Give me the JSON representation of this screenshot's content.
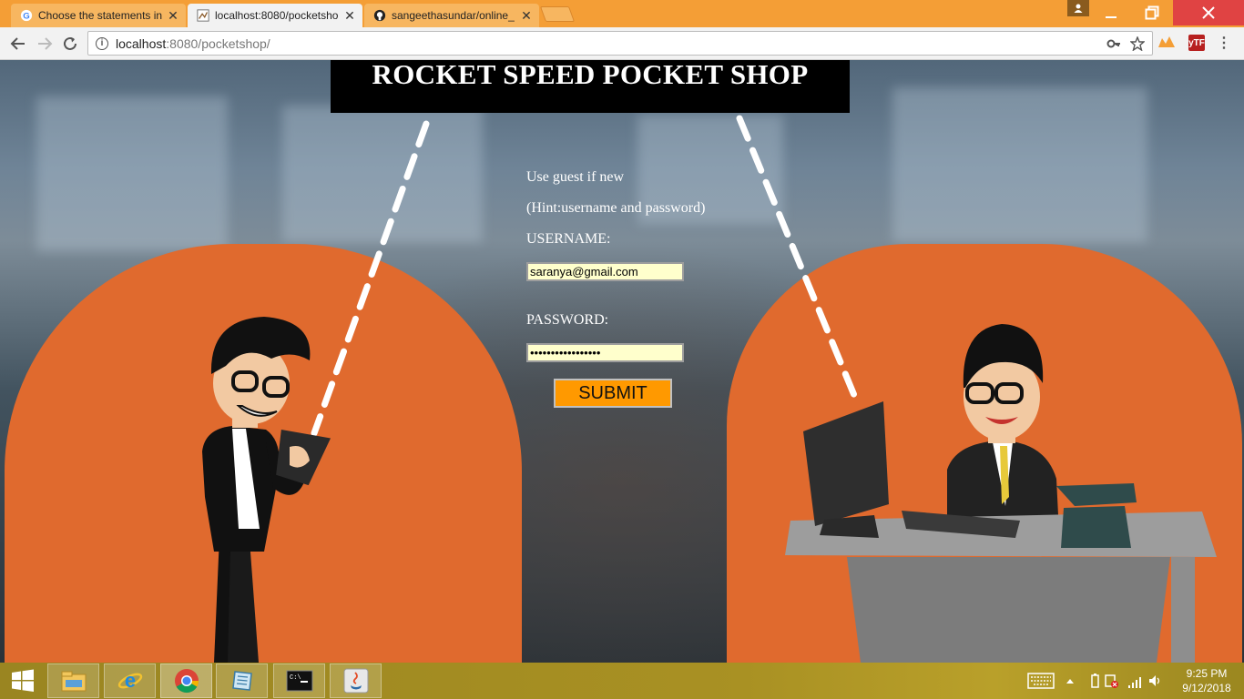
{
  "browser": {
    "tabs": [
      {
        "title": "Choose the statements in",
        "favicon": "google-icon",
        "active": false
      },
      {
        "title": "localhost:8080/pocketsho",
        "favicon": "page-icon",
        "active": true
      },
      {
        "title": "sangeethasundar/online_",
        "favicon": "github-icon",
        "active": false
      }
    ],
    "url_host": "localhost",
    "url_path": ":8080/pocketshop/"
  },
  "page": {
    "title": "ROCKET SPEED POCKET SHOP",
    "hint_guest": "Use guest if new",
    "hint_creds": "(Hint:username and password)",
    "username_label": "USERNAME:",
    "username_value": "saranya@gmail.com",
    "password_label": "PASSWORD:",
    "password_value": "•••••••••••••••••",
    "submit_label": "SUBMIT"
  },
  "taskbar": {
    "time": "9:25 PM",
    "date": "9/12/2018",
    "items": [
      "file-explorer-icon",
      "internet-explorer-icon",
      "chrome-icon",
      "notebook-app-icon",
      "command-prompt-icon",
      "java-icon"
    ]
  },
  "colors": {
    "accent_orange": "#e06a2e",
    "chrome_frame": "#f49e36",
    "submit": "#ff9900",
    "input_bg": "#ffffcc"
  }
}
